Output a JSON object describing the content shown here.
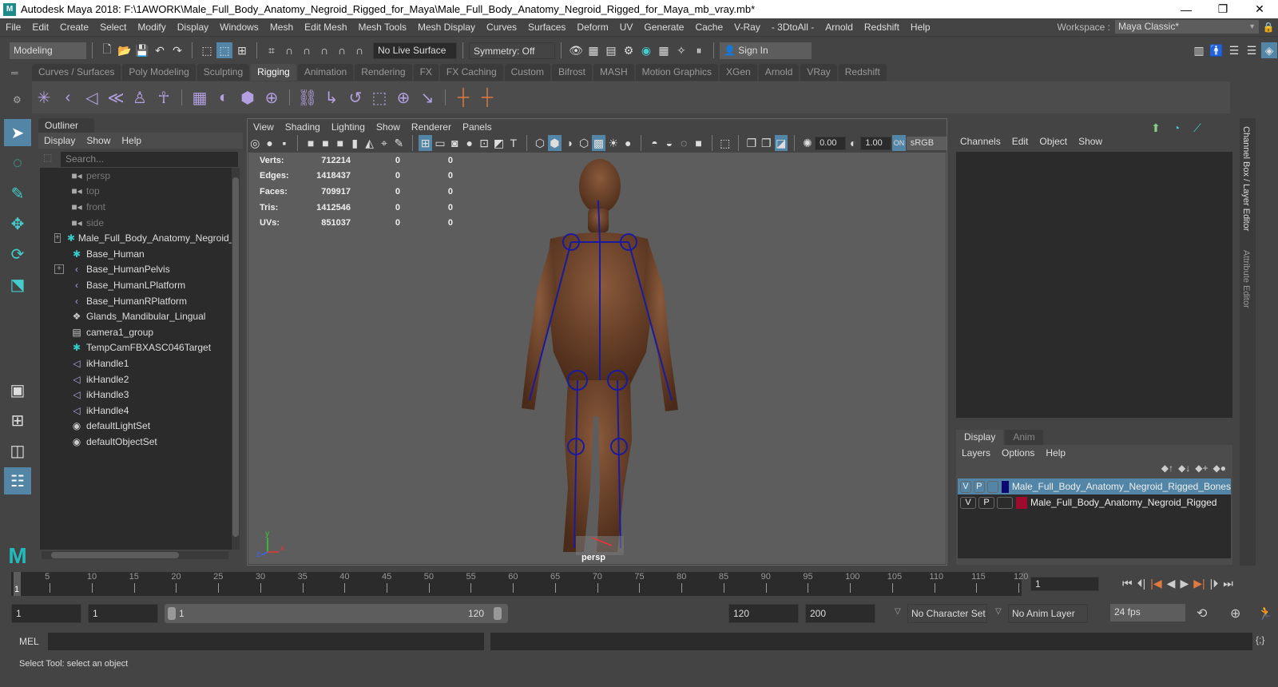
{
  "window": {
    "title": "Autodesk Maya 2018: F:\\1AWORK\\Male_Full_Body_Anatomy_Negroid_Rigged_for_Maya\\Male_Full_Body_Anatomy_Negroid_Rigged_for_Maya_mb_vray.mb*",
    "logo": "M",
    "minimize": "—",
    "maximize": "❐",
    "close": "✕"
  },
  "menubar": [
    "File",
    "Edit",
    "Create",
    "Select",
    "Modify",
    "Display",
    "Windows",
    "Mesh",
    "Edit Mesh",
    "Mesh Tools",
    "Mesh Display",
    "Curves",
    "Surfaces",
    "Deform",
    "UV",
    "Generate",
    "Cache",
    "V-Ray",
    "- 3DtoAll -",
    "Arnold",
    "Redshift",
    "Help"
  ],
  "workspace": {
    "label": "Workspace :",
    "value": "Maya Classic*"
  },
  "statusline": {
    "mode": "Modeling",
    "live_surface": "No Live Surface",
    "symmetry": "Symmetry: Off",
    "sign_in": "Sign In"
  },
  "shelf": {
    "tabs": [
      "Curves / Surfaces",
      "Poly Modeling",
      "Sculpting",
      "Rigging",
      "Animation",
      "Rendering",
      "FX",
      "FX Caching",
      "Custom",
      "Bifrost",
      "MASH",
      "Motion Graphics",
      "XGen",
      "Arnold",
      "VRay",
      "Redshift"
    ],
    "active": "Rigging"
  },
  "outliner": {
    "title": "Outliner",
    "menu": [
      "Display",
      "Show",
      "Help"
    ],
    "search_placeholder": "Search...",
    "items": [
      {
        "name": "persp",
        "icon": "camera-icon",
        "dim": true,
        "expandable": false
      },
      {
        "name": "top",
        "icon": "camera-icon",
        "dim": true,
        "expandable": false
      },
      {
        "name": "front",
        "icon": "camera-icon",
        "dim": true,
        "expandable": false
      },
      {
        "name": "side",
        "icon": "camera-icon",
        "dim": true,
        "expandable": false
      },
      {
        "name": "Male_Full_Body_Anatomy_Negroid_Ri",
        "icon": "locator-icon",
        "dim": false,
        "expandable": true
      },
      {
        "name": "Base_Human",
        "icon": "locator-icon",
        "dim": false,
        "expandable": false
      },
      {
        "name": "Base_HumanPelvis",
        "icon": "joint-icon",
        "dim": false,
        "expandable": true
      },
      {
        "name": "Base_HumanLPlatform",
        "icon": "joint-icon",
        "dim": false,
        "expandable": false
      },
      {
        "name": "Base_HumanRPlatform",
        "icon": "joint-icon",
        "dim": false,
        "expandable": false
      },
      {
        "name": "Glands_Mandibular_Lingual",
        "icon": "group-icon",
        "dim": false,
        "expandable": false
      },
      {
        "name": "camera1_group",
        "icon": "camera-group-icon",
        "dim": false,
        "expandable": false
      },
      {
        "name": "TempCamFBXASC046Target",
        "icon": "locator-icon",
        "dim": false,
        "expandable": false
      },
      {
        "name": "ikHandle1",
        "icon": "ik-handle-icon",
        "dim": false,
        "expandable": false
      },
      {
        "name": "ikHandle2",
        "icon": "ik-handle-icon",
        "dim": false,
        "expandable": false
      },
      {
        "name": "ikHandle3",
        "icon": "ik-handle-icon",
        "dim": false,
        "expandable": false
      },
      {
        "name": "ikHandle4",
        "icon": "ik-handle-icon",
        "dim": false,
        "expandable": false
      },
      {
        "name": "defaultLightSet",
        "icon": "set-icon",
        "dim": false,
        "expandable": false
      },
      {
        "name": "defaultObjectSet",
        "icon": "set-icon",
        "dim": false,
        "expandable": false
      }
    ]
  },
  "viewport": {
    "menu": [
      "View",
      "Shading",
      "Lighting",
      "Show",
      "Renderer",
      "Panels"
    ],
    "exposure": "0.00",
    "gamma": "1.00",
    "colorspace": "sRGB gam",
    "camera_label": "persp",
    "hud": [
      {
        "label": "Verts:",
        "v1": "712214",
        "v2": "0",
        "v3": "0"
      },
      {
        "label": "Edges:",
        "v1": "1418437",
        "v2": "0",
        "v3": "0"
      },
      {
        "label": "Faces:",
        "v1": "709917",
        "v2": "0",
        "v3": "0"
      },
      {
        "label": "Tris:",
        "v1": "1412546",
        "v2": "0",
        "v3": "0"
      },
      {
        "label": "UVs:",
        "v1": "851037",
        "v2": "0",
        "v3": "0"
      }
    ],
    "axis": {
      "x": "x",
      "y": "y",
      "z": "z"
    }
  },
  "channelbox": {
    "menu": [
      "Channels",
      "Edit",
      "Object",
      "Show"
    ]
  },
  "layers": {
    "tabs": [
      "Display",
      "Anim"
    ],
    "menu": [
      "Layers",
      "Options",
      "Help"
    ],
    "rows": [
      {
        "v": "V",
        "p": "P",
        "color": "#0a0a6e",
        "name": "Male_Full_Body_Anatomy_Negroid_Rigged_Bones",
        "selected": true
      },
      {
        "v": "V",
        "p": "P",
        "color": "#9e0b2e",
        "name": "Male_Full_Body_Anatomy_Negroid_Rigged",
        "selected": false
      }
    ]
  },
  "sidetabs": [
    "Channel Box / Layer Editor",
    "Attribute Editor"
  ],
  "timeline": {
    "ticks": [
      "5",
      "10",
      "15",
      "20",
      "25",
      "30",
      "35",
      "40",
      "45",
      "50",
      "55",
      "60",
      "65",
      "70",
      "75",
      "80",
      "85",
      "90",
      "95",
      "100",
      "105",
      "110",
      "115",
      "120"
    ],
    "current_frame_label": "1",
    "current_frame": "1"
  },
  "range": {
    "start": "1",
    "playback_start": "1",
    "slider_start": "1",
    "slider_end": "120",
    "playback_end": "120",
    "end": "200",
    "character_set": "No Character Set",
    "anim_layer": "No Anim Layer",
    "fps": "24 fps"
  },
  "cmdline": {
    "label": "MEL"
  },
  "helpline": {
    "text": "Select Tool: select an object"
  }
}
